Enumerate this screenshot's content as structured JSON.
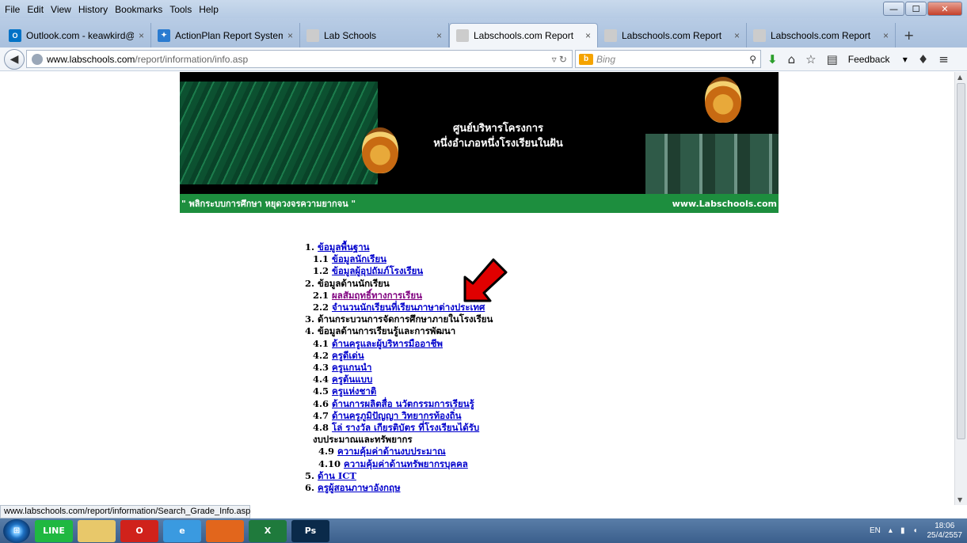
{
  "menubar": [
    "File",
    "Edit",
    "View",
    "History",
    "Bookmarks",
    "Tools",
    "Help"
  ],
  "window_controls": {
    "minimize": "—",
    "maximize": "☐",
    "close": "✕"
  },
  "tabs": [
    {
      "label": "Outlook.com - keawkird@...",
      "icon": "O",
      "icon_color": "#0072c6",
      "active": false
    },
    {
      "label": "ActionPlan Report System",
      "icon": "✦",
      "icon_color": "#2a7bd0",
      "active": false
    },
    {
      "label": "Lab Schools",
      "icon": "",
      "icon_color": "#cccccc",
      "active": false
    },
    {
      "label": "Labschools.com Report",
      "icon": "",
      "icon_color": "#cccccc",
      "active": true
    },
    {
      "label": "Labschools.com Report",
      "icon": "",
      "icon_color": "#cccccc",
      "active": false
    },
    {
      "label": "Labschools.com Report",
      "icon": "",
      "icon_color": "#cccccc",
      "active": false
    }
  ],
  "url": {
    "host": "www.labschools.com",
    "path": "/report/information/info.asp"
  },
  "search": {
    "placeholder": "Bing"
  },
  "feedback_label": "Feedback",
  "banner": {
    "title_line1": "ศูนย์บริหารโครงการ",
    "title_line2": "หนึ่งอำเภอหนึ่งโรงเรียนในฝัน",
    "slogan": "\" พลิกระบบการศึกษา หยุดวงจรความยากจน \"",
    "site": "www.Labschools.com"
  },
  "menu": [
    {
      "num": "1.",
      "label": "ข้อมูลพื้นฐาน",
      "link": true,
      "level": 1
    },
    {
      "num": "1.1",
      "label": "ข้อมูลนักเรียน",
      "link": true,
      "level": 2
    },
    {
      "num": "1.2",
      "label": "ข้อมูลผู้อุปถัมภ์โรงเรียน",
      "link": true,
      "level": 2
    },
    {
      "num": "2.",
      "label": "ข้อมูลด้านนักเรียน",
      "link": false,
      "level": 1
    },
    {
      "num": "2.1",
      "label": "ผลสัมฤทธิ์ทางการเรียน",
      "link": true,
      "level": 2,
      "visited": true
    },
    {
      "num": "2.2",
      "label": "จำนวนนักเรียนที่เรียนภาษาต่างประเทศ",
      "link": true,
      "level": 2
    },
    {
      "num": "3.",
      "label": "ด้านกระบวนการจัดการศึกษาภายในโรงเรียน",
      "link": false,
      "level": 1
    },
    {
      "num": "4.",
      "label": "ข้อมูลด้านการเรียนรู้และการพัฒนา",
      "link": false,
      "level": 1
    },
    {
      "num": "4.1",
      "label": "ด้านครูและผู้บริหารมืออาชีพ",
      "link": true,
      "level": 2
    },
    {
      "num": "4.2",
      "label": "ครูดีเด่น",
      "link": true,
      "level": 2
    },
    {
      "num": "4.3",
      "label": "ครูแกนนำ",
      "link": true,
      "level": 2
    },
    {
      "num": "4.4",
      "label": "ครูต้นแบบ",
      "link": true,
      "level": 2
    },
    {
      "num": "4.5",
      "label": "ครูแห่งชาติ",
      "link": true,
      "level": 2
    },
    {
      "num": "4.6",
      "label": "ด้านการผลิตสื่อ นวัตกรรมการเรียนรู้",
      "link": true,
      "level": 2
    },
    {
      "num": "4.7",
      "label": "ด้านครูภูมิปัญญา วิทยากรท้องถิ่น",
      "link": true,
      "level": 2
    },
    {
      "num": "4.8",
      "label": "โล่ รางวัล เกียรติบัตร ที่โรงเรียนได้รับ",
      "link": true,
      "level": 2
    },
    {
      "num": "",
      "label": "งบประมาณและทรัพยากร",
      "link": false,
      "level": 2
    },
    {
      "num": "4.9",
      "label": "ความคุ้มค่าด้านงบประมาณ",
      "link": true,
      "level": 3
    },
    {
      "num": "4.10",
      "label": "ความคุ้มค่าด้านทรัพยากรบุคคล",
      "link": true,
      "level": 3
    },
    {
      "num": "5.",
      "label": "ด้าน ICT",
      "link": true,
      "level": 1
    },
    {
      "num": "6.",
      "label": "ครูผู้สอนภาษาอังกฤษ",
      "link": true,
      "level": 1
    }
  ],
  "status_text": "www.labschools.com/report/information/Search_Grade_Info.asp",
  "taskbar": [
    {
      "name": "line",
      "label": "LINE",
      "color": "#1fb841"
    },
    {
      "name": "explorer",
      "label": "",
      "color": "#e8c86a"
    },
    {
      "name": "opera",
      "label": "O",
      "color": "#d0221b"
    },
    {
      "name": "ie",
      "label": "e",
      "color": "#3a9ae0"
    },
    {
      "name": "firefox",
      "label": "",
      "color": "#e2661c"
    },
    {
      "name": "excel",
      "label": "X",
      "color": "#1f7a3c"
    },
    {
      "name": "photoshop",
      "label": "Ps",
      "color": "#0a2a4a"
    }
  ],
  "tray": {
    "lang": "EN",
    "time": "18:06",
    "date": "25/4/2557"
  }
}
